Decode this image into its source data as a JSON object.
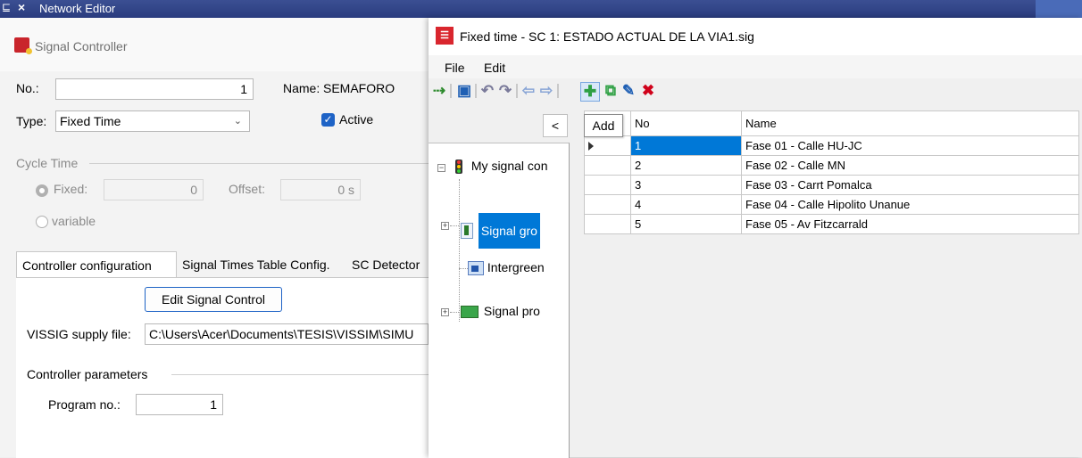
{
  "network_editor": {
    "title": "Network Editor",
    "pin_glyph": "⊑",
    "close_glyph": "×"
  },
  "signal_controller": {
    "title": "Signal Controller",
    "no_label": "No.:",
    "no_value": "1",
    "name_label": "Name:",
    "name_value": "SEMAFORO",
    "type_label": "Type:",
    "type_value": "Fixed Time",
    "active_label": "Active",
    "cycle_time_label": "Cycle Time",
    "fixed_label": "Fixed:",
    "fixed_value": "0",
    "offset_label": "Offset:",
    "offset_value": "0 s",
    "variable_label": "variable",
    "tabs": [
      "Controller configuration",
      "Signal Times Table Config.",
      "SC Detector"
    ],
    "edit_button": "Edit Signal Control",
    "supply_label": "VISSIG supply file:",
    "supply_value": "C:\\Users\\Acer\\Documents\\TESIS\\VISSIM\\SIMU",
    "params_label": "Controller parameters",
    "program_label": "Program no.:",
    "program_value": "1"
  },
  "fixed_time": {
    "title": "Fixed time - SC 1: ESTADO ACTUAL DE LA VIA1.sig",
    "menu": [
      "File",
      "Edit"
    ],
    "collapse_glyph": "<",
    "tooltip": "Add",
    "tree": {
      "root": "My signal con",
      "items": [
        "Signal gro",
        "Intergreen",
        "Signal pro"
      ]
    },
    "table": {
      "headers": [
        "No",
        "Name"
      ],
      "rows": [
        {
          "no": "1",
          "name": "Fase 01 - Calle HU-JC"
        },
        {
          "no": "2",
          "name": "Fase 02 - Calle MN"
        },
        {
          "no": "3",
          "name": "Fase 03 - Carrt Pomalca"
        },
        {
          "no": "4",
          "name": "Fase 04 - Calle Hipolito Unanue"
        },
        {
          "no": "5",
          "name": "Fase 05 - Av Fitzcarrald"
        }
      ]
    }
  },
  "colors": {
    "accent": "#0078d7",
    "title_bar": "#2a3c7f",
    "delete_red": "#d0021b",
    "add_green": "#2ea043"
  }
}
